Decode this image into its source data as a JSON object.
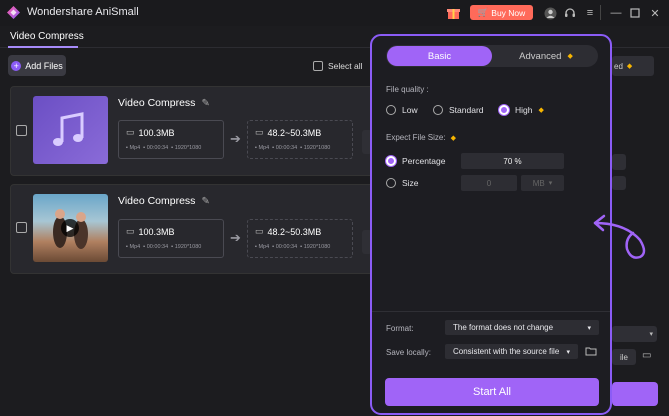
{
  "app": {
    "title": "Wondershare AniSmall",
    "buy_now": "Buy Now"
  },
  "tabs": {
    "video_compress": "Video Compress"
  },
  "toolbar": {
    "add_files": "Add Files",
    "select_all": "Select all"
  },
  "videos": [
    {
      "name": "Video Compress",
      "orig_size": "100.3MB",
      "orig_format": "Mp4",
      "orig_duration": "00:00:34",
      "orig_resolution": "1920*1080",
      "target_size": "48.2~50.3MB",
      "target_format": "Mp4",
      "target_duration": "00:00:34",
      "target_resolution": "1920*1080"
    },
    {
      "name": "Video Compress",
      "orig_size": "100.3MB",
      "orig_format": "Mp4",
      "orig_duration": "00:00:34",
      "orig_resolution": "1920*1080",
      "target_size": "48.2~50.3MB",
      "target_format": "Mp4",
      "target_duration": "00:00:34",
      "target_resolution": "1920*1080"
    }
  ],
  "panel": {
    "tab_basic": "Basic",
    "tab_advanced": "Advanced",
    "file_quality_label": "File quality :",
    "quality_options": [
      "Low",
      "Standard",
      "High"
    ],
    "quality_selected": "High",
    "expect_size_label": "Expect File Size:",
    "percentage_label": "Percentage",
    "percentage_value": "70 %",
    "size_label": "Size",
    "size_value": "0",
    "size_unit": "MB",
    "format_label": "Format:",
    "format_value": "The format does not change",
    "save_label": "Save locally:",
    "save_value": "Consistent with the source file",
    "start_all": "Start All"
  },
  "background": {
    "right_label_1": "ed",
    "right_label_2": "ile"
  },
  "colors": {
    "accent": "#a064f7",
    "buy_now": "#ff6a5a",
    "premium": "#f7b500"
  }
}
